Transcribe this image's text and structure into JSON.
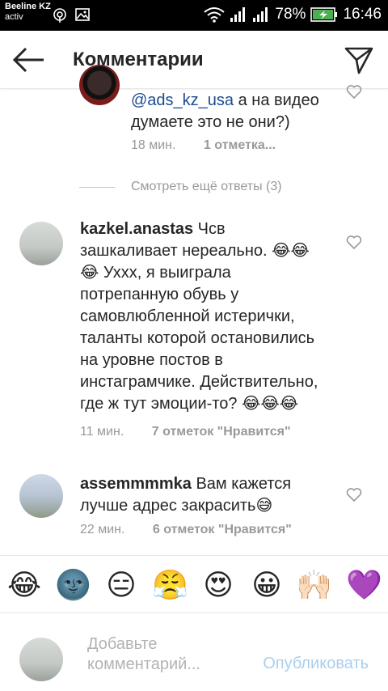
{
  "status_bar": {
    "carrier": "Beeline KZ",
    "carrier_sub": "activ",
    "battery": "78%",
    "time": "16:46",
    "icons_left": [
      "hotspot-icon",
      "image-icon"
    ],
    "icons_right": [
      "wifi-icon",
      "signal-icon",
      "signal-icon",
      "battery-icon"
    ]
  },
  "header": {
    "title": "Комментарии",
    "back_icon": "arrow-left-icon",
    "send_icon": "paper-plane-icon"
  },
  "comments": [
    {
      "username": "",
      "mention": "@ads_kz_usa",
      "text": "а на видео думаете это не они?)",
      "time": "18 мин.",
      "likes": "1 отметка...",
      "liked": false
    },
    {
      "username": "kazkel.anastas",
      "mention": "",
      "text": "Чсв зашкаливает нереально. 😂😂 😂 Ухxx, я выиграла потрепанную обувь у самовлюбленной истерички, таланты которой остановились на уровне постов в инстаграмчике. Действительно, где ж тут эмоции-то? 😂😂😂",
      "time": "11 мин.",
      "likes": "7 отметок \"Нравится\"",
      "liked": false
    },
    {
      "username": "assemmmmka",
      "mention": "",
      "text": "Вам кажется лучше адрес закрасить😅",
      "time": "22 мин.",
      "likes": "6 отметок \"Нравится\"",
      "liked": false
    }
  ],
  "view_more_replies": "Смотреть ещё ответы (3)",
  "emoji_bar": [
    "😂",
    "🌚",
    "😑",
    "😤",
    "😍",
    "😀",
    "🙌🏻",
    "💜"
  ],
  "composer": {
    "placeholder": "Добавьте комментарий...",
    "post_label": "Опубликовать"
  },
  "colors": {
    "mention": "#1e4b8f",
    "meta": "#999999",
    "post_disabled": "#a9cfee"
  }
}
